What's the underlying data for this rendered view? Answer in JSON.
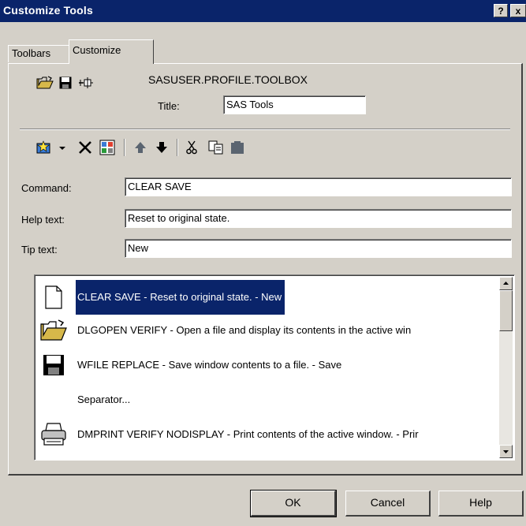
{
  "window": {
    "title": "Customize Tools",
    "help_button": "?",
    "close_button": "x"
  },
  "tabs": [
    {
      "label": "Toolbars",
      "active": false
    },
    {
      "label": "Customize",
      "active": true
    }
  ],
  "toolbox": {
    "name": "SASUSER.PROFILE.TOOLBOX",
    "title_label": "Title:",
    "title_value": "SAS Tools"
  },
  "fields": {
    "command_label": "Command:",
    "command_value": "CLEAR SAVE",
    "help_label": "Help text:",
    "help_value": "Reset to original state.",
    "tip_label": "Tip text:",
    "tip_value": "New"
  },
  "tools": [
    {
      "icon": "new-document-icon",
      "text": "CLEAR SAVE - Reset to original state. - New",
      "selected": true
    },
    {
      "icon": "open-folder-icon",
      "text": "DLGOPEN VERIFY - Open a file and display its contents in the active win",
      "selected": false
    },
    {
      "icon": "floppy-disk-icon",
      "text": "WFILE REPLACE - Save window contents to a file. - Save",
      "selected": false
    },
    {
      "icon": "",
      "text": "Separator...",
      "selected": false
    },
    {
      "icon": "printer-icon",
      "text": "DMPRINT VERIFY NODISPLAY - Print contents of the active window. - Prir",
      "selected": false
    }
  ],
  "buttons": {
    "ok": "OK",
    "cancel": "Cancel",
    "help": "Help"
  },
  "colors": {
    "titlebar": "#0a246a",
    "face": "#d4d0c8",
    "selection": "#0a246a"
  }
}
